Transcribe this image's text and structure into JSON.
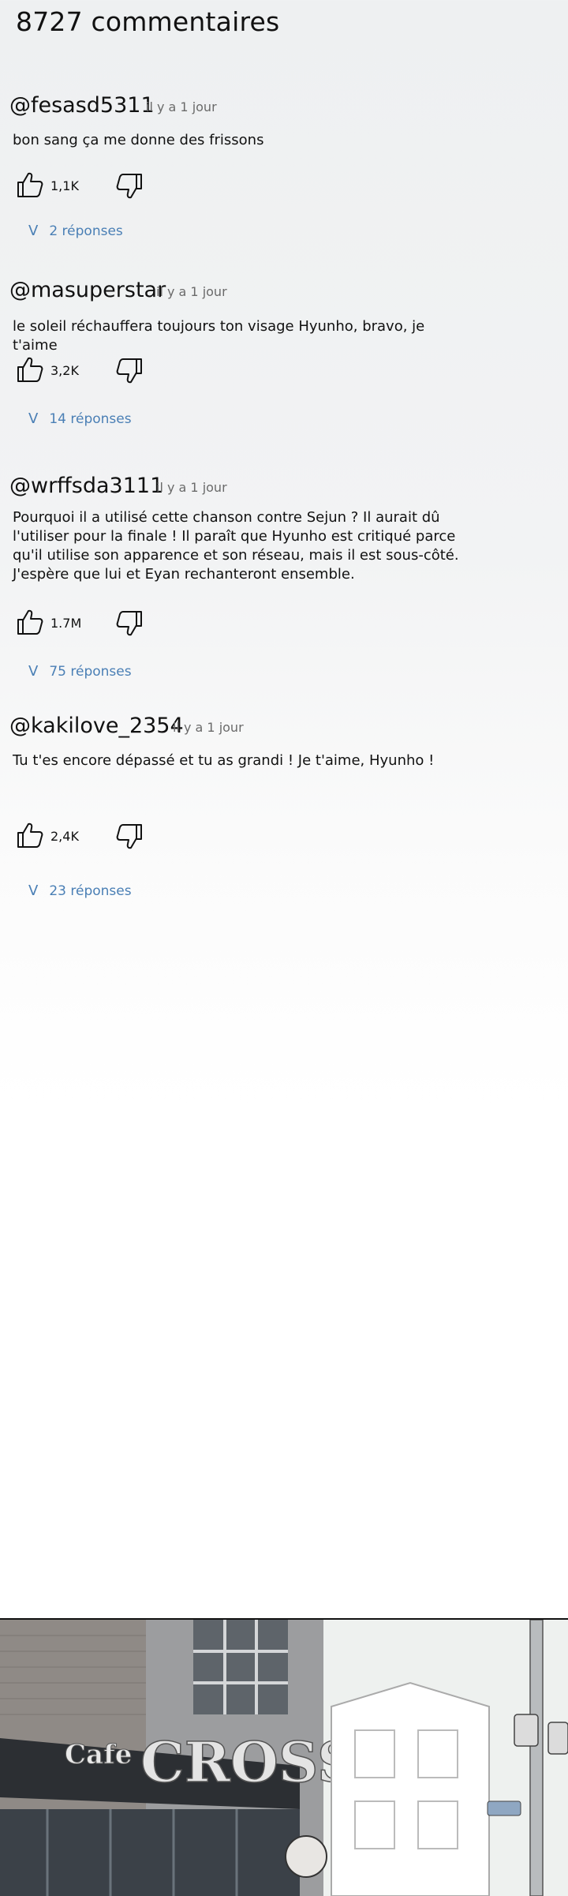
{
  "header": {
    "title": "8727 commentaires"
  },
  "comments": [
    {
      "user": "@fesasd5311",
      "time": "il y a 1 jour",
      "text": "bon sang ça me donne des frissons",
      "likes": "1,1K",
      "replies_chevron": "V",
      "replies": "2 réponses"
    },
    {
      "user": "@masuperstar",
      "time": "il y a 1 jour",
      "text": "le soleil réchauffera toujours ton visage Hyunho, bravo, je t'aime",
      "likes": "3,2K",
      "replies_chevron": "V",
      "replies": "14 réponses"
    },
    {
      "user": "@wrffsda3111",
      "time": "il y a 1 jour",
      "text": "Pourquoi il a utilisé cette chanson contre Sejun ? Il aurait dû l'utiliser pour la finale ! Il paraît que Hyunho est critiqué parce qu'il utilise son apparence et son réseau, mais il est sous-côté. J'espère que lui et Eyan rechanteront ensemble.",
      "likes": "1.7M",
      "replies_chevron": "V",
      "replies": "75 réponses"
    },
    {
      "user": "@kakilove_2354",
      "time": "il y a 1 jour",
      "text": "Tu t'es encore dépassé et tu as grandi ! Je t'aime, Hyunho !",
      "likes": "2,4K",
      "replies_chevron": "V",
      "replies": "23 réponses"
    }
  ],
  "icons": {
    "like": "thumbs-up-icon",
    "dislike": "thumbs-down-icon"
  },
  "scene": {
    "sign_small": "Cafe",
    "sign_large": "CROSS"
  }
}
